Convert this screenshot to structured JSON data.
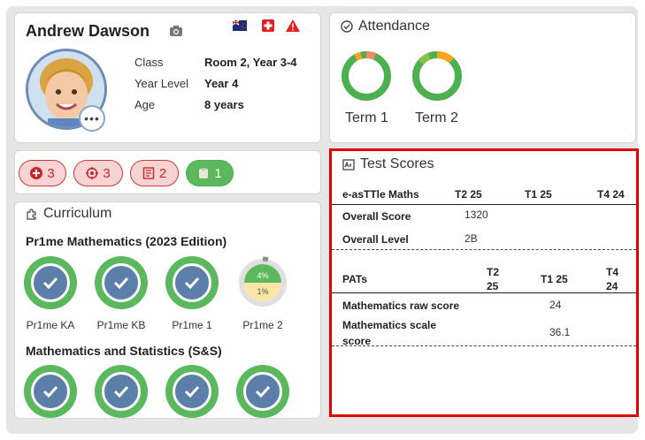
{
  "profile": {
    "name": "Andrew Dawson",
    "class_label": "Class",
    "class_value": "Room 2, Year 3-4",
    "year_label": "Year Level",
    "year_value": "Year 4",
    "age_label": "Age",
    "age_value": "8 years",
    "more_label": "•••"
  },
  "attendance": {
    "title": "Attendance",
    "terms": [
      {
        "label": "Term 1"
      },
      {
        "label": "Term 2"
      }
    ]
  },
  "badges": [
    {
      "count": "3",
      "icon": "medical-plus-icon",
      "color": "red"
    },
    {
      "count": "3",
      "icon": "target-icon",
      "color": "red"
    },
    {
      "count": "2",
      "icon": "notes-icon",
      "color": "red"
    },
    {
      "count": "1",
      "icon": "clipboard-icon",
      "color": "green"
    }
  ],
  "curriculum": {
    "title": "Curriculum",
    "section1": "Pr1me Mathematics (2023 Edition)",
    "courses": [
      {
        "label": "Pr1me KA"
      },
      {
        "label": "Pr1me KB"
      },
      {
        "label": "Pr1me 1"
      },
      {
        "label": "Pr1me 2",
        "progress_top": "4%",
        "progress_bottom": "1%"
      }
    ],
    "section2": "Mathematics and Statistics (S&S)"
  },
  "tests": {
    "title": "Test Scores",
    "table1": {
      "heading": "e-asTTle Maths",
      "cols": [
        "T2 25",
        "T1 25",
        "T4 24"
      ],
      "rows": [
        {
          "label": "Overall Score",
          "value": "1320"
        },
        {
          "label": "Overall Level",
          "value": "2B"
        }
      ]
    },
    "table2": {
      "heading": "PATs",
      "col1_a": "T2",
      "col1_b": "25",
      "col2": "T1 25",
      "col3_a": "T4",
      "col3_b": "24",
      "rows": [
        {
          "label": "Mathematics raw score",
          "value": "24"
        },
        {
          "label_a": "Mathematics scale",
          "label_b": "score",
          "value": "36.1"
        }
      ]
    }
  },
  "colors": {
    "accent_green": "#5cb85c",
    "accent_red": "#e00000",
    "badge_red": "#c62828",
    "ring_blue": "#5b7fa8"
  }
}
